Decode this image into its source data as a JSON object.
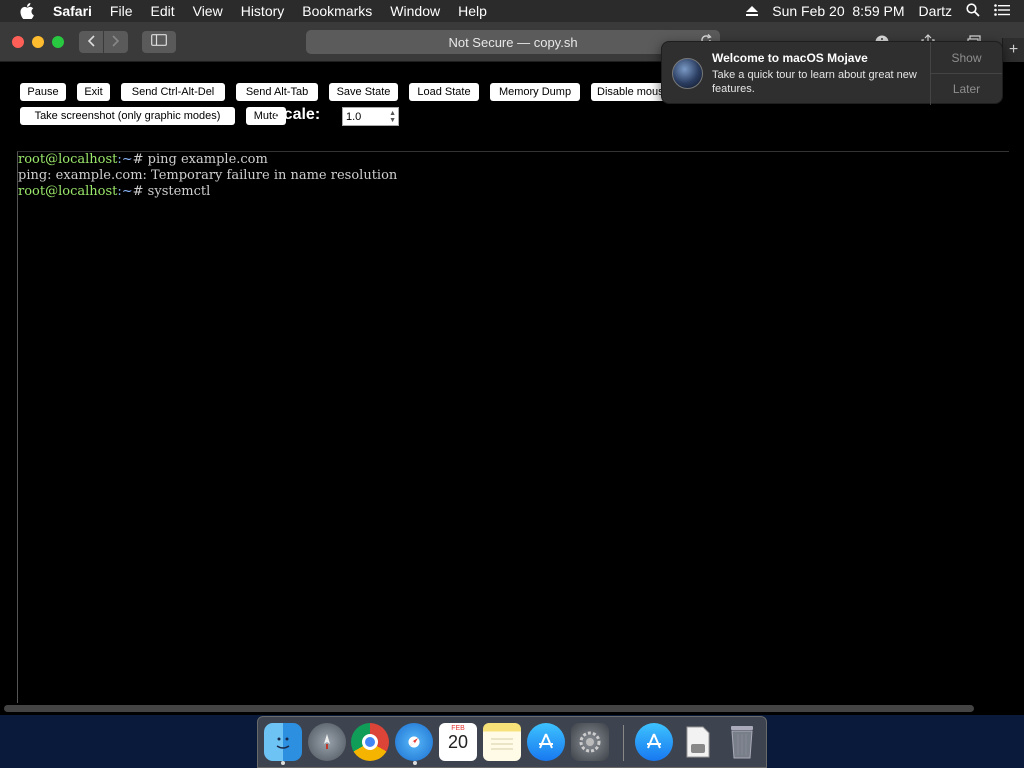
{
  "menubar": {
    "app_name": "Safari",
    "menus": [
      "File",
      "Edit",
      "View",
      "History",
      "Bookmarks",
      "Window",
      "Help"
    ],
    "datetime": "Sun Feb 20  8:59 PM",
    "user": "Dartz",
    "icons": [
      "apple-icon",
      "eject-icon",
      "spotlight-search-icon",
      "notification-center-icon"
    ]
  },
  "browser": {
    "address": "Not Secure — copy.sh",
    "icons": [
      "back-icon",
      "forward-icon",
      "sidebar-icon",
      "reload-icon",
      "info-icon",
      "share-icon",
      "tabs-icon",
      "new-tab-icon"
    ]
  },
  "controls": {
    "buttons": [
      "Pause",
      "Exit",
      "Send Ctrl-Alt-Del",
      "Send Alt-Tab",
      "Save State",
      "Load State",
      "Memory Dump",
      "Disable mouse",
      "Take screenshot (only graphic modes)",
      "Mute"
    ],
    "scale_label": "Scale:",
    "scale_value": "1.0"
  },
  "terminal": {
    "lines": [
      {
        "user": "root@localhost",
        "path": ":~",
        "cmd": "# ping example.com"
      },
      {
        "text": "ping: example.com: Temporary failure in name resolution"
      },
      {
        "user": "root@localhost",
        "path": ":~",
        "cmd": "# systemctl"
      }
    ]
  },
  "notification": {
    "title": "Welcome to macOS Mojave",
    "body": "Take a quick tour to learn about great new features.",
    "action_show": "Show",
    "action_later": "Later"
  },
  "dock": {
    "calendar_month": "FEB",
    "calendar_day": "20",
    "items": [
      "finder-icon",
      "launchpad-icon",
      "chrome-icon",
      "safari-icon",
      "calendar-icon",
      "notes-icon",
      "app-store-icon",
      "system-preferences-icon",
      "app-store-downloads-icon",
      "file-icon",
      "trash-icon"
    ]
  }
}
